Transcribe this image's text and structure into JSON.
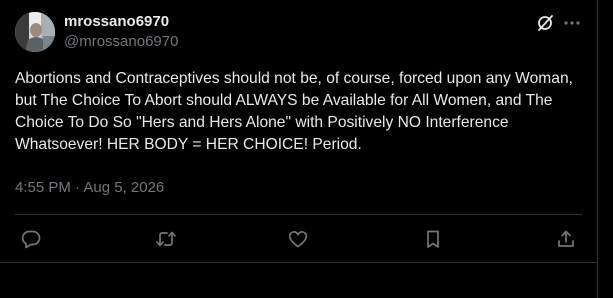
{
  "tweet": {
    "display_name": "mrossano6970",
    "handle": "@mrossano6970",
    "text": "Abortions and Contraceptives should not be, of course, forced upon any Woman, but The Choice To Abort should ALWAYS be Available for All Women, and The Choice To Do So \"Hers and Hers Alone\" with Positively NO Interference Whatsoever! HER BODY = HER CHOICE! Period.",
    "timestamp": "4:55 PM · Aug 5, 2026"
  },
  "icons": {
    "header": [
      "grok-icon",
      "more-icon"
    ],
    "actions": [
      "reply-icon",
      "retweet-icon",
      "like-icon",
      "bookmark-icon",
      "share-icon"
    ]
  },
  "colors": {
    "background": "#000000",
    "text_primary": "#e7e9ea",
    "text_secondary": "#71767b",
    "border": "#2f3336"
  }
}
